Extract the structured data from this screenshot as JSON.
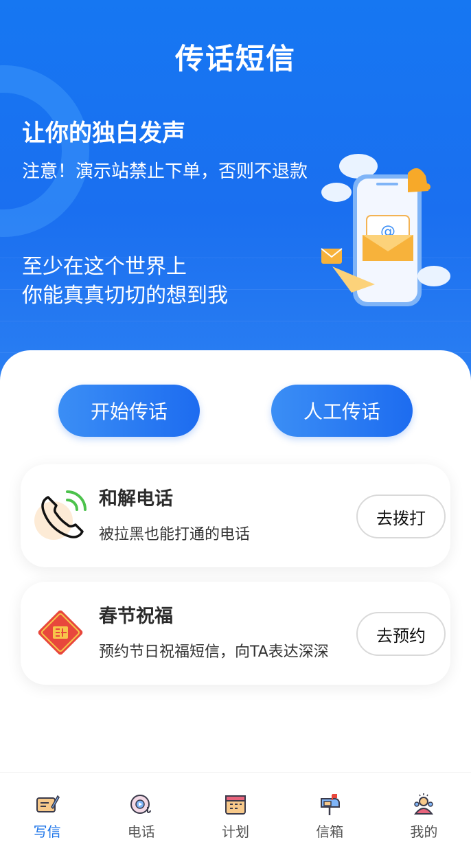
{
  "header": {
    "title": "传话短信",
    "slogan": "让你的独白发声",
    "notice": "注意！演示站禁止下单，否则不退款",
    "poem_line1": "至少在这个世界上",
    "poem_line2": "你能真真切切的想到我"
  },
  "actions": {
    "start_label": "开始传话",
    "manual_label": "人工传话"
  },
  "services": [
    {
      "title": "和解电话",
      "desc": "被拉黑也能打通的电话",
      "button": "去拨打",
      "icon": "phone-icon"
    },
    {
      "title": "春节祝福",
      "desc": "预约节日祝福短信，向TA表达深深",
      "button": "去预约",
      "icon": "fu-icon"
    }
  ],
  "tabbar": {
    "items": [
      {
        "label": "写信",
        "icon": "write-letter-icon",
        "active": true
      },
      {
        "label": "电话",
        "icon": "phone-record-icon",
        "active": false
      },
      {
        "label": "计划",
        "icon": "calendar-icon",
        "active": false
      },
      {
        "label": "信箱",
        "icon": "mailbox-icon",
        "active": false
      },
      {
        "label": "我的",
        "icon": "profile-icon",
        "active": false
      }
    ]
  },
  "colors": {
    "primary": "#1a6ff0",
    "active_tab": "#1a73e8",
    "text": "#2b2b2b"
  }
}
